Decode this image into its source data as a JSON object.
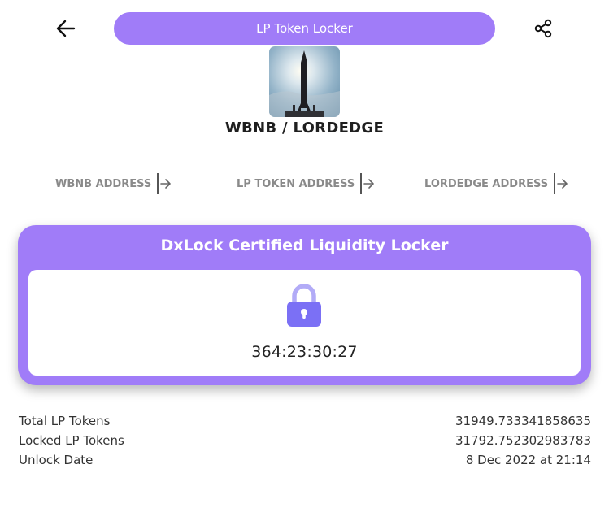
{
  "header": {
    "title": "LP Token Locker",
    "back_icon": "arrow-left-icon",
    "share_icon": "share-icon"
  },
  "token": {
    "image": "rocket-photo",
    "pair_name": "WBNB / LORDEDGE"
  },
  "address_links": [
    {
      "label": "WBNB ADDRESS",
      "icon": "arrow-right-bar-icon"
    },
    {
      "label": "LP TOKEN ADDRESS",
      "icon": "arrow-right-bar-icon"
    },
    {
      "label": "LORDEDGE ADDRESS",
      "icon": "arrow-right-bar-icon"
    }
  ],
  "locker": {
    "title": "DxLock Certified Liquidity Locker",
    "lock_icon": "lock-icon",
    "countdown": "364:23:30:27"
  },
  "stats": [
    {
      "label": "Total LP Tokens",
      "value": "31949.733341858635"
    },
    {
      "label": "Locked LP Tokens",
      "value": "31792.752302983783"
    },
    {
      "label": "Unlock Date",
      "value": "8 Dec 2022 at 21:14"
    }
  ],
  "colors": {
    "accent": "#a07cf8",
    "lock": "#7b70f5"
  }
}
